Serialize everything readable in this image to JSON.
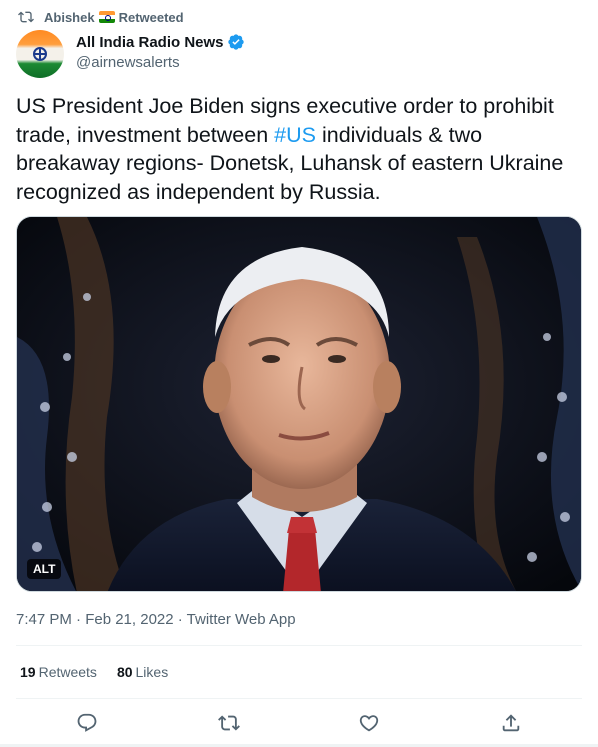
{
  "context": {
    "retweeter": "Abishek",
    "retweeted_label": "Retweeted"
  },
  "author": {
    "name": "All India Radio News",
    "handle": "@airnewsalerts"
  },
  "tweet": {
    "text_before": "US President Joe Biden signs executive order to prohibit trade, investment between ",
    "hashtag": "#US",
    "text_after": " individuals & two breakaway regions- Donetsk, Luhansk of eastern Ukraine recognized as independent by Russia."
  },
  "media": {
    "alt_badge": "ALT"
  },
  "meta": {
    "time": "7:47 PM · Feb 21, 2022 · Twitter Web App"
  },
  "stats": {
    "retweets_count": "19",
    "retweets_label": "Retweets",
    "likes_count": "80",
    "likes_label": "Likes"
  },
  "colors": {
    "link": "#1d9bf0",
    "secondary_text": "#536471",
    "verified": "#1d9bf0"
  },
  "icons": [
    "retweet-icon",
    "flag-india-icon",
    "verified-badge-icon",
    "reply-icon",
    "retweet-icon",
    "like-icon",
    "share-icon"
  ]
}
